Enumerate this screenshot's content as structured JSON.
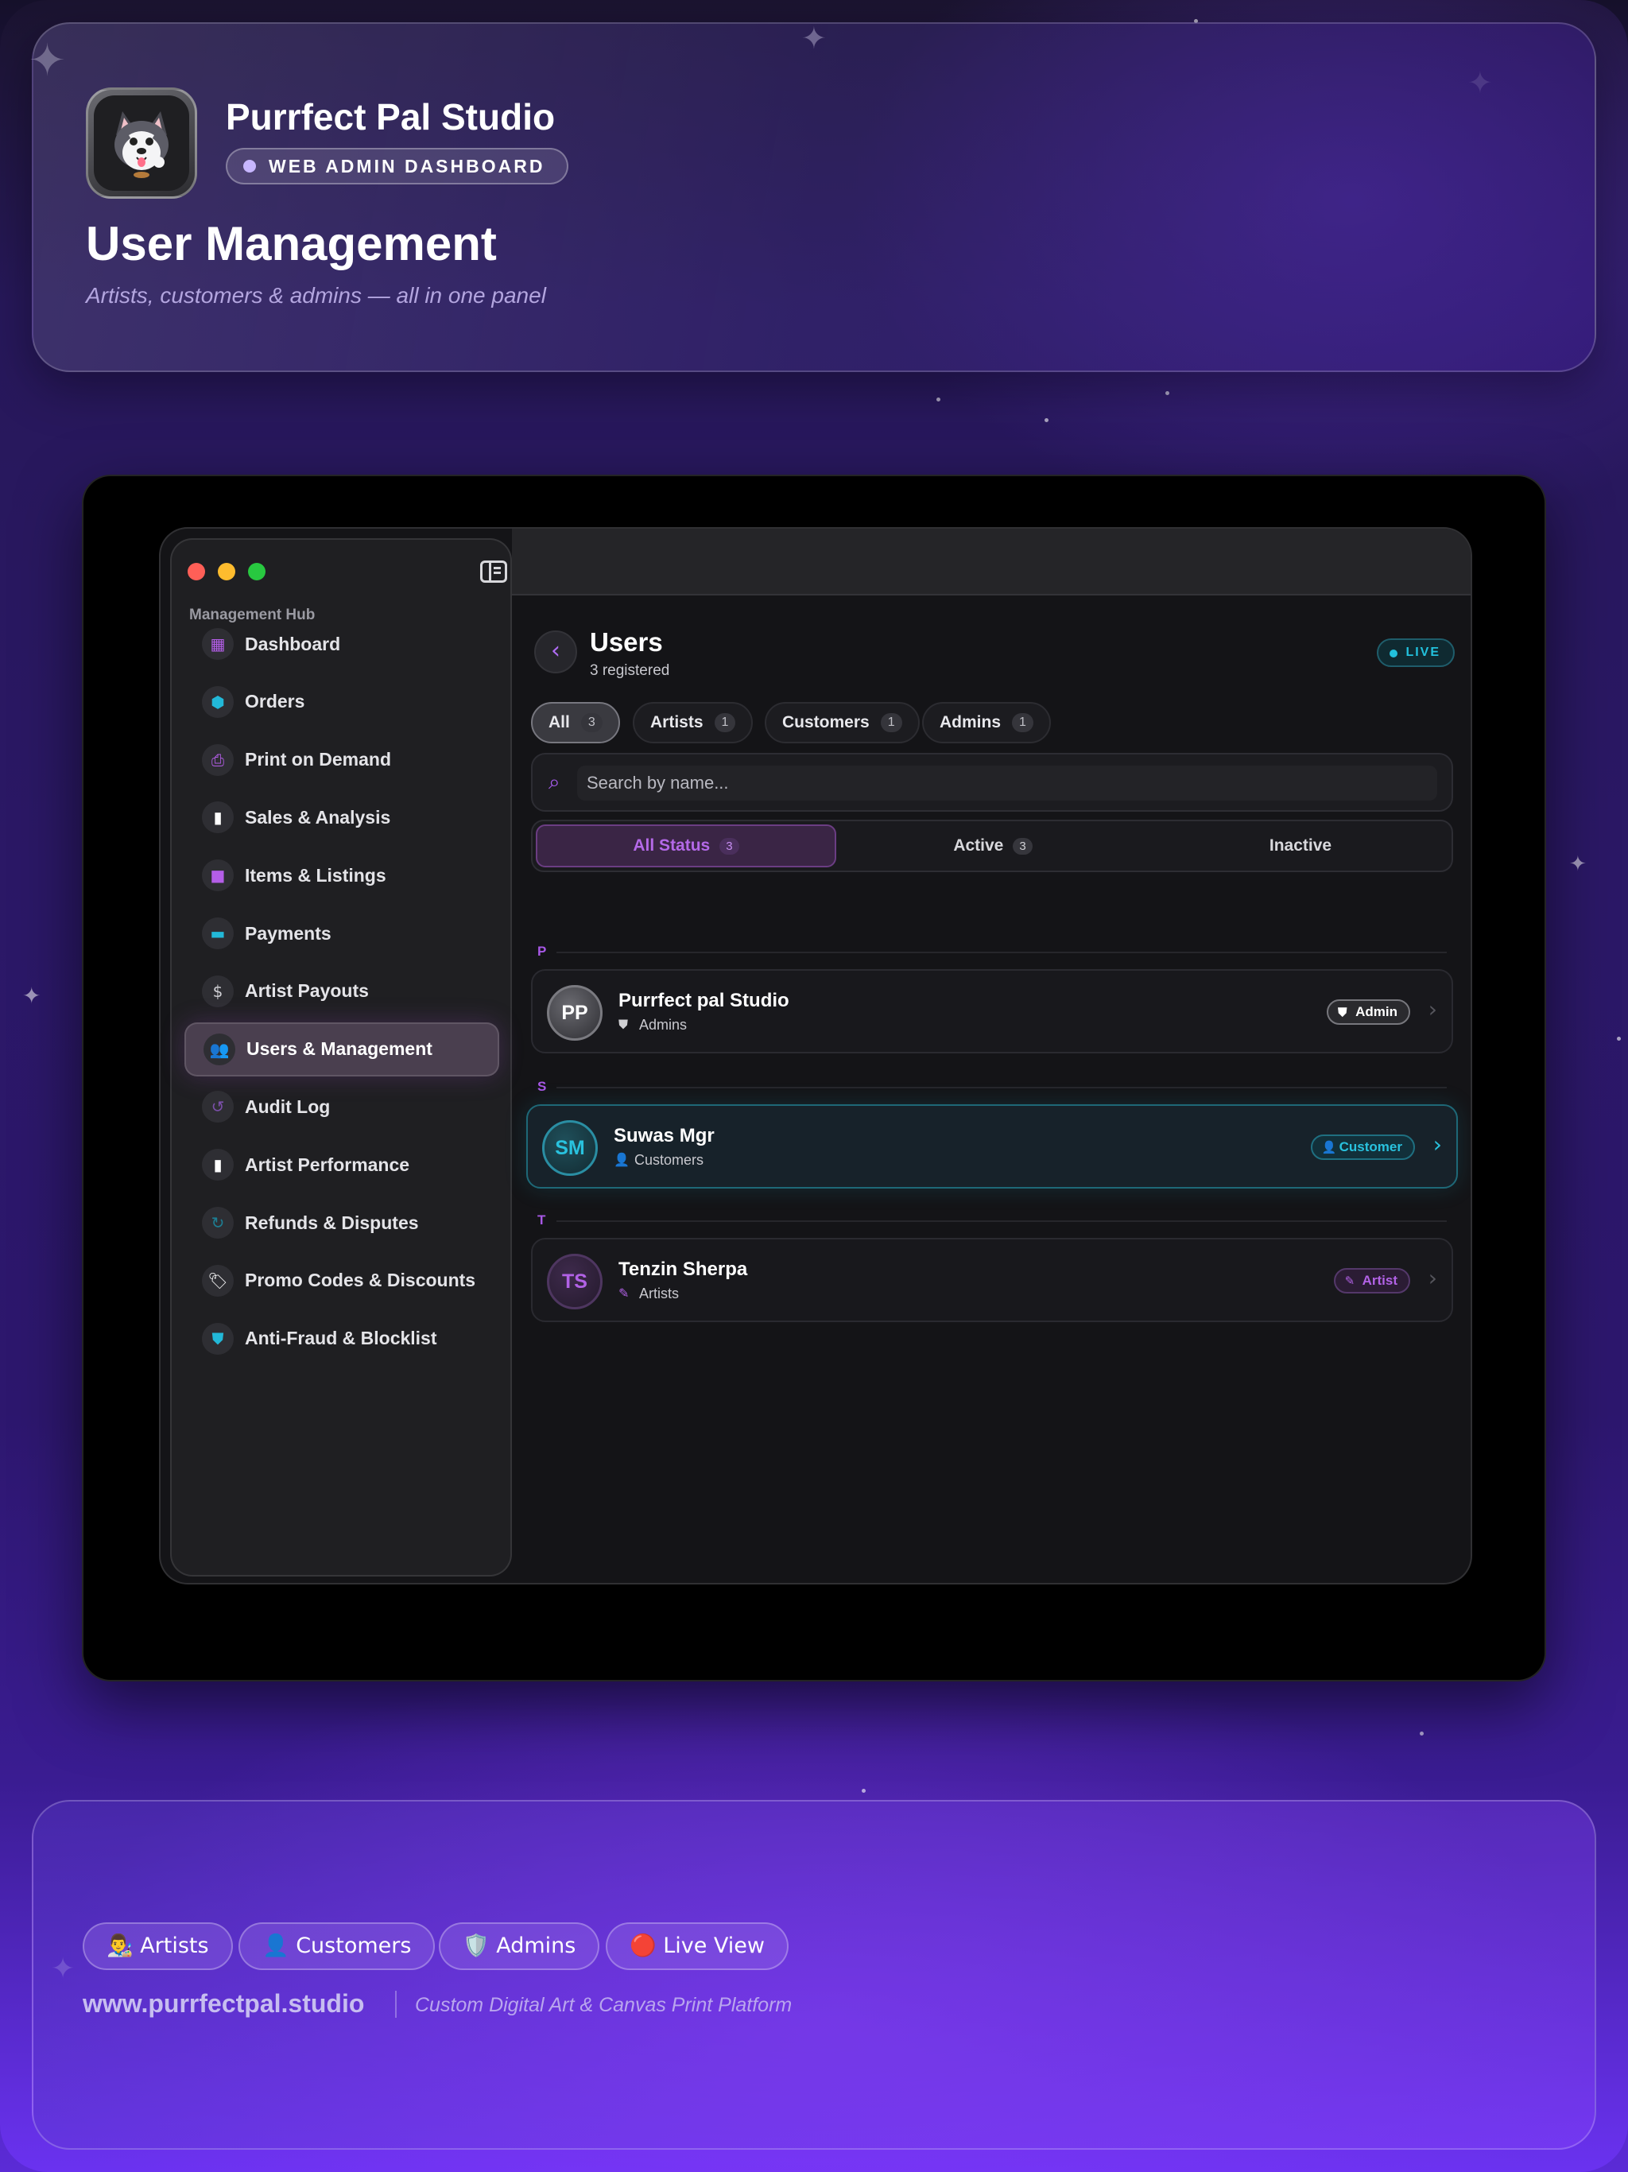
{
  "header": {
    "brand_name": "Purrfect Pal Studio",
    "brand_pill": "WEB ADMIN DASHBOARD",
    "title": "User Management",
    "subtitle": "Artists, customers & admins — all in one panel"
  },
  "sidebar": {
    "section_label": "Management Hub",
    "items": [
      {
        "label": "Dashboard",
        "icon": "grid-icon",
        "glyph": "▦",
        "color": "#b45ee8"
      },
      {
        "label": "Orders",
        "icon": "box-icon",
        "glyph": "⬢",
        "color": "#22b8d8"
      },
      {
        "label": "Print on Demand",
        "icon": "printer-icon",
        "glyph": "⎙",
        "color": "#b45ee8"
      },
      {
        "label": "Sales & Analysis",
        "icon": "bar-chart-icon",
        "glyph": "▮",
        "color": "#ffffff"
      },
      {
        "label": "Items & Listings",
        "icon": "bag-icon",
        "glyph": "■",
        "color": "#b45ee8"
      },
      {
        "label": "Payments",
        "icon": "credit-card-icon",
        "glyph": "▬",
        "color": "#22b8d8"
      },
      {
        "label": "Artist Payouts",
        "icon": "dollar-icon",
        "glyph": "$",
        "color": "#cfcfd4"
      },
      {
        "label": "Users & Management",
        "icon": "users-icon",
        "glyph": "👥",
        "color": "#b45ee8",
        "active": true
      },
      {
        "label": "Audit Log",
        "icon": "history-icon",
        "glyph": "↺",
        "color": "#7a4fa8"
      },
      {
        "label": "Artist Performance",
        "icon": "bar-chart-icon",
        "glyph": "▮",
        "color": "#ffffff"
      },
      {
        "label": "Refunds & Disputes",
        "icon": "refund-icon",
        "glyph": "↻",
        "color": "#1d7e93"
      },
      {
        "label": "Promo Codes & Discounts",
        "icon": "tag-icon",
        "glyph": "🏷",
        "color": "#ffffff"
      },
      {
        "label": "Anti-Fraud & Blocklist",
        "icon": "shield-icon",
        "glyph": "⛊",
        "color": "#22b8d8"
      }
    ]
  },
  "users_panel": {
    "title": "Users",
    "subtitle": "3 registered",
    "live": "LIVE",
    "tabs": [
      {
        "label": "All",
        "count": "3",
        "active": true
      },
      {
        "label": "Artists",
        "count": "1"
      },
      {
        "label": "Customers",
        "count": "1"
      },
      {
        "label": "Admins",
        "count": "1"
      }
    ],
    "search_placeholder": "Search by name...",
    "status_filters": [
      {
        "label": "All Status",
        "count": "3",
        "active": true
      },
      {
        "label": "Active",
        "count": "3"
      },
      {
        "label": "Inactive",
        "count": ""
      }
    ],
    "groups": [
      {
        "letter": "P",
        "user": {
          "initials": "PP",
          "name": "Purrfect pal Studio",
          "role": "Admins",
          "badge": "Admin",
          "type": "admin"
        }
      },
      {
        "letter": "S",
        "user": {
          "initials": "SM",
          "name": "Suwas Mgr",
          "role": "Customers",
          "badge": "Customer",
          "type": "customer"
        }
      },
      {
        "letter": "T",
        "user": {
          "initials": "TS",
          "name": "Tenzin Sherpa",
          "role": "Artists",
          "badge": "Artist",
          "type": "artist"
        }
      }
    ]
  },
  "footer": {
    "chips": [
      "👨‍🎨 Artists",
      "👤 Customers",
      "🛡️ Admins",
      "🔴 Live View"
    ],
    "site": "www.purrfectpal.studio",
    "tagline": "Custom Digital Art & Canvas Print Platform"
  },
  "colors": {
    "accent_purple": "#b45ee8",
    "accent_cyan": "#22c1dd"
  }
}
